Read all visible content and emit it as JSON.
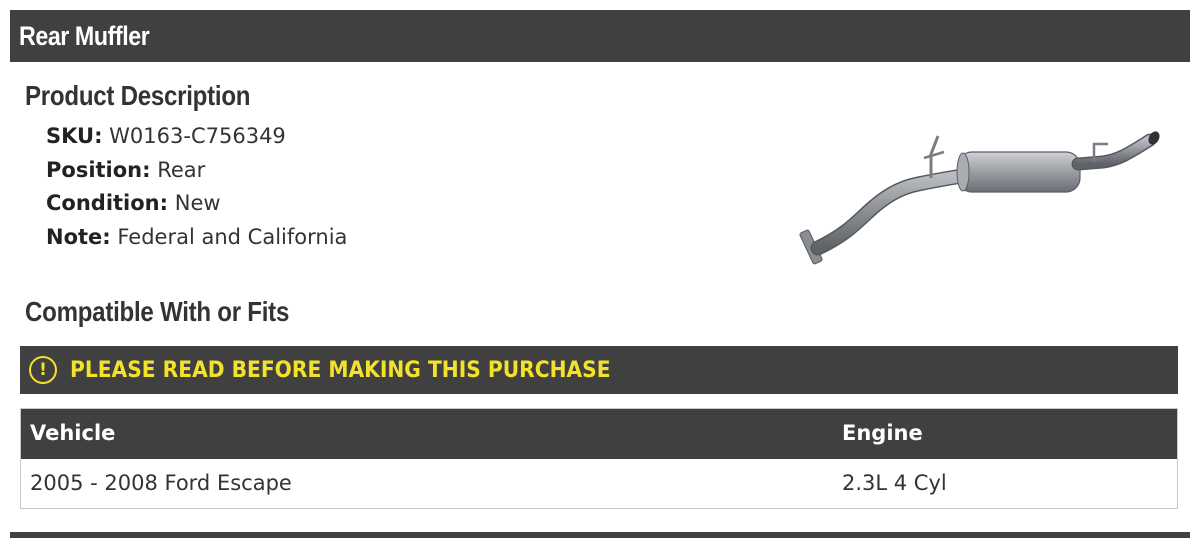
{
  "header": {
    "title": "Rear Muffler"
  },
  "product_description": {
    "heading": "Product Description",
    "specs": [
      {
        "label": "SKU:",
        "value": "W0163-C756349"
      },
      {
        "label": "Position:",
        "value": "Rear"
      },
      {
        "label": "Condition:",
        "value": "New"
      },
      {
        "label": "Note:",
        "value": "Federal and California"
      }
    ],
    "image_icon": "muffler-exhaust-pipe-image"
  },
  "compatibility": {
    "heading": "Compatible With or Fits",
    "warning": {
      "icon": "exclamation-circle-icon",
      "text": "PLEASE READ BEFORE MAKING THIS PURCHASE"
    },
    "table": {
      "columns": [
        "Vehicle",
        "Engine"
      ],
      "rows": [
        [
          "2005 - 2008 Ford Escape",
          "2.3L 4 Cyl"
        ]
      ]
    }
  },
  "colors": {
    "bar_background": "#404040",
    "warning_text": "#f4e22a",
    "body_text": "#333333"
  }
}
